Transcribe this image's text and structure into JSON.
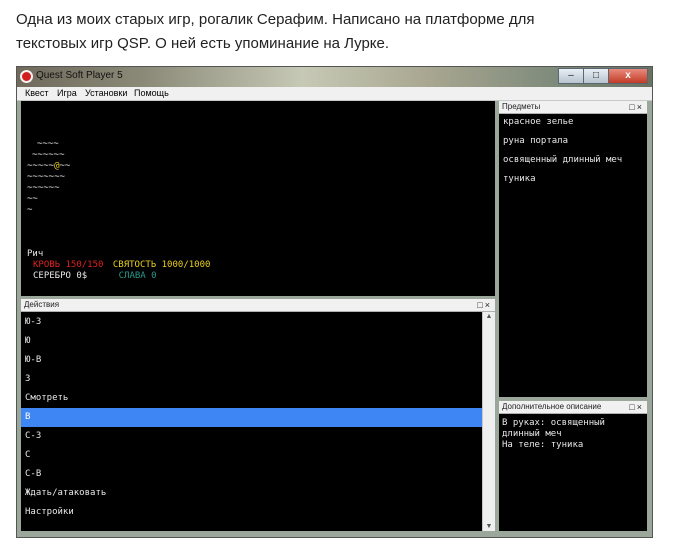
{
  "caption": {
    "line1": "Одна из моих старых игр, рогалик Серафим. Написано на платформе для",
    "line2": "текстовых игр QSP. О ней есть упоминание на Лурке."
  },
  "window": {
    "title": "Quest Soft Player 5",
    "minimize_label": "–",
    "maximize_label": "□",
    "close_label": "x"
  },
  "menu": [
    "Квест",
    "Игра",
    "Установки",
    "Помощь"
  ],
  "main": {
    "map_lines": [
      "~~~~",
      "~~~~~~",
      "~~~~~@~~",
      "~~~~~~~",
      "~~~~~~",
      "~~",
      "~"
    ],
    "name": "Рич",
    "hp": "КРОВЬ 150/150",
    "holiness": "СВЯТОСТЬ 1000/1000",
    "silver": "СЕРЕБРО 0$",
    "glory": "СЛАВА 0"
  },
  "items_pane": {
    "title": "Предметы",
    "controls": "□×",
    "items": [
      "красное зелье",
      "руна портала",
      "освященный длинный меч",
      "туника"
    ]
  },
  "actions_pane": {
    "title": "Действия",
    "controls": "□×",
    "selected_index": 5,
    "items": [
      "Ю-З",
      "Ю",
      "Ю-В",
      "З",
      "Смотреть",
      "В",
      "С-З",
      "С",
      "С-В",
      "Ждать/атаковать",
      "Настройки"
    ]
  },
  "desc_pane": {
    "title": "Дополнительное описание",
    "controls": "□×",
    "lines": [
      "В руках: освященный",
      "длинный меч",
      "На теле: туника"
    ]
  },
  "colors": {
    "hp": "#e02020",
    "holiness": "#e8d020",
    "glory": "#2a9a8a",
    "selection": "#3f86f5"
  }
}
